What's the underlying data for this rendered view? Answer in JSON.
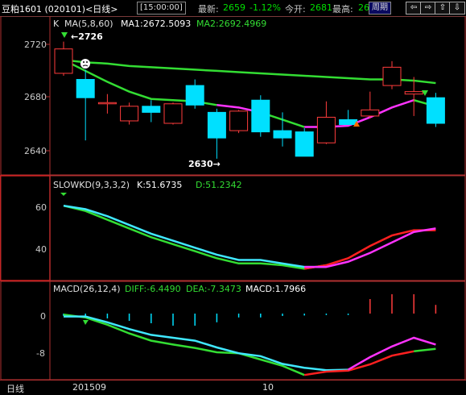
{
  "topbar": {
    "title": "豆粕1601 (020101)<日线>",
    "time": "[15:00:00]",
    "latest_label": "最新:",
    "latest_value": "2659",
    "change_pct": "-1.12%",
    "open_label": "今开:",
    "open_value": "2681",
    "high_label": "最高:",
    "high_value": "26",
    "cycle_label": "周期",
    "nav": [
      "⇦",
      "⇨",
      "⇧",
      "⇩"
    ]
  },
  "price_panel": {
    "header_k": "K",
    "header_ma": "MA(5,8,60)",
    "ma1": "MA1:2672.5093",
    "ma2": "MA2:2692.4969",
    "y_ticks": [
      "2720",
      "2680",
      "2640"
    ],
    "annot_high": "2726",
    "annot_low": "2630"
  },
  "kd_panel": {
    "header": "SLOWKD(9,3,3,2)",
    "k": "K:51.6735",
    "d": "D:51.2342",
    "y_ticks": [
      "60",
      "40"
    ]
  },
  "macd_panel": {
    "header": "MACD(26,12,4)",
    "diff": "DIFF:-6.4490",
    "dea": "DEA:-7.3473",
    "macd": "MACD:1.7966",
    "y_ticks": [
      "0",
      "-8"
    ]
  },
  "bottom": {
    "period_label": "日线",
    "date_left": "201509",
    "date_mid": "10"
  },
  "colors": {
    "up": "#ff3c3c",
    "down": "#00e0ff",
    "ma_green": "#33dd33",
    "ma_magenta": "#ff33ff",
    "kd_cyan": "#40e8ff",
    "red": "#ff2020"
  },
  "chart_data": {
    "type": "candlestick",
    "candles": [
      {
        "o": 2700,
        "h": 2726,
        "l": 2698,
        "c": 2720
      },
      {
        "o": 2695,
        "h": 2703,
        "l": 2645,
        "c": 2680
      },
      {
        "o": 2676,
        "h": 2683,
        "l": 2667,
        "c": 2676
      },
      {
        "o": 2661,
        "h": 2676,
        "l": 2658,
        "c": 2673
      },
      {
        "o": 2673,
        "h": 2678,
        "l": 2660,
        "c": 2668
      },
      {
        "o": 2659,
        "h": 2676,
        "l": 2658,
        "c": 2675
      },
      {
        "o": 2690,
        "h": 2695,
        "l": 2671,
        "c": 2674
      },
      {
        "o": 2668,
        "h": 2671,
        "l": 2630,
        "c": 2647
      },
      {
        "o": 2653,
        "h": 2670,
        "l": 2651,
        "c": 2669
      },
      {
        "o": 2678,
        "h": 2682,
        "l": 2648,
        "c": 2652
      },
      {
        "o": 2653,
        "h": 2668,
        "l": 2640,
        "c": 2647
      },
      {
        "o": 2652,
        "h": 2655,
        "l": 2632,
        "c": 2632
      },
      {
        "o": 2643,
        "h": 2677,
        "l": 2642,
        "c": 2664
      },
      {
        "o": 2662,
        "h": 2670,
        "l": 2658,
        "c": 2658
      },
      {
        "o": 2665,
        "h": 2685,
        "l": 2663,
        "c": 2670
      },
      {
        "o": 2690,
        "h": 2710,
        "l": 2687,
        "c": 2705
      },
      {
        "o": 2683,
        "h": 2697,
        "l": 2665,
        "c": 2685
      },
      {
        "o": 2680,
        "h": 2684,
        "l": 2656,
        "c": 2659
      }
    ],
    "ma_fast": [
      2711,
      2702,
      2693,
      2685,
      2679,
      2678,
      2677,
      2674,
      2672,
      2668,
      2662,
      2656,
      2656,
      2657,
      2664,
      2672,
      2678,
      2673
    ],
    "ma_fast_magenta_from": 9,
    "ma_slow": [
      2711,
      2709,
      2708,
      2706,
      2705,
      2704,
      2703,
      2702,
      2701,
      2700,
      2699,
      2698,
      2697,
      2696,
      2695,
      2695,
      2694,
      2692
    ],
    "price_ylim": [
      2620,
      2735
    ],
    "kd_k": [
      65,
      63,
      59,
      54,
      49,
      45,
      41,
      37,
      34,
      34,
      32,
      30,
      30,
      33,
      38,
      44,
      50,
      52
    ],
    "kd_d": [
      65,
      62,
      57,
      52,
      47,
      43,
      39,
      35,
      32,
      32,
      31,
      29,
      31,
      35,
      42,
      48,
      51,
      51
    ],
    "kd_ylim": [
      25,
      72
    ],
    "macd_diff": [
      -0.6,
      -0.6,
      -1.8,
      -3.2,
      -4.4,
      -5.0,
      -5.6,
      -7.0,
      -8.2,
      -8.8,
      -10.4,
      -11.2,
      -11.7,
      -11.6,
      -9.0,
      -6.8,
      -5.0,
      -6.4
    ],
    "macd_dea": [
      -0.2,
      -0.8,
      -2.3,
      -4.1,
      -5.6,
      -6.4,
      -7.1,
      -8.0,
      -8.2,
      -9.5,
      -10.8,
      -12.7,
      -12.0,
      -11.8,
      -10.5,
      -8.7,
      -7.8,
      -7.3
    ],
    "macd_hist": [
      -0.5,
      -0.8,
      -1.0,
      -1.5,
      -2.0,
      -2.5,
      -2.5,
      -1.8,
      -0.8,
      -0.8,
      -0.5,
      -0.4,
      -0.3,
      -0.3,
      3.0,
      4.0,
      4.0,
      1.8
    ],
    "macd_ylim": [
      -13.5,
      3.5
    ]
  }
}
